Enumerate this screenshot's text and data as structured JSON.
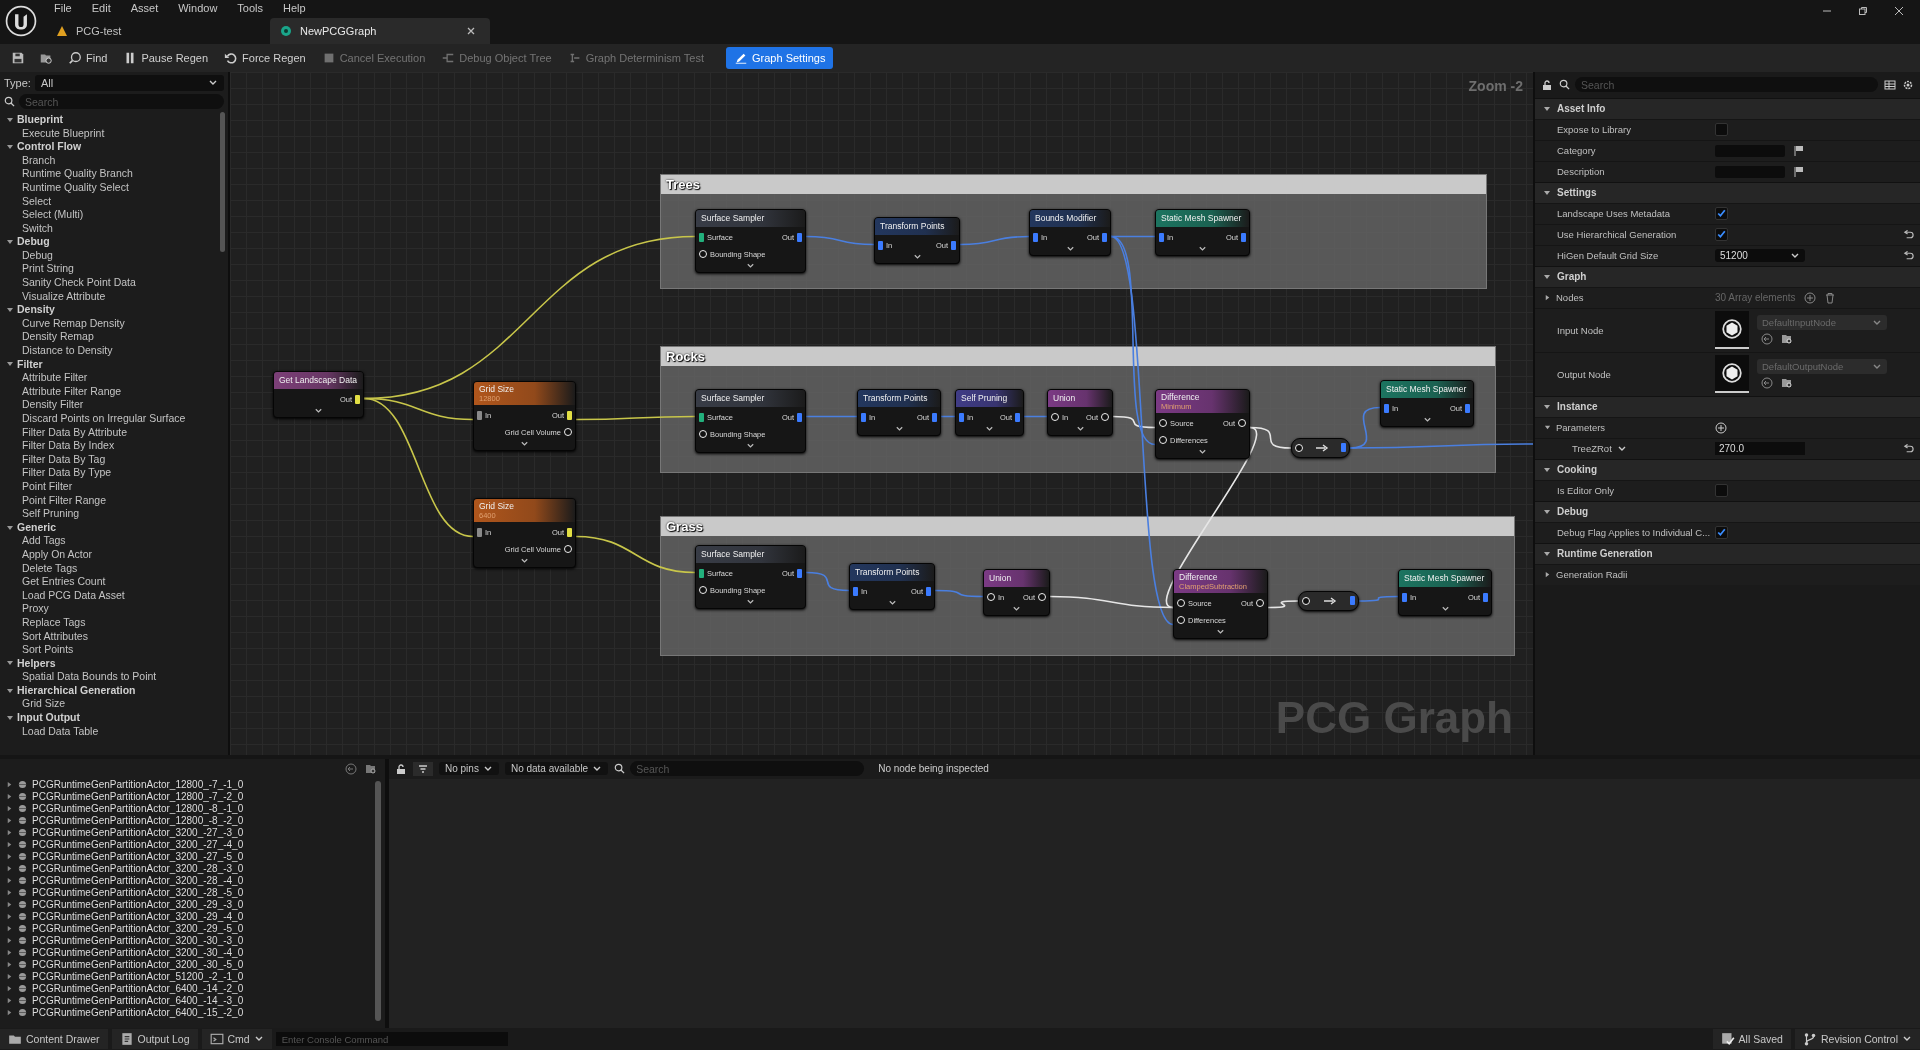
{
  "window": {
    "menu": [
      "File",
      "Edit",
      "Asset",
      "Window",
      "Tools",
      "Help"
    ],
    "tabs": [
      {
        "label": "PCG-test",
        "kind": "level",
        "selected": false
      },
      {
        "label": "NewPCGGraph",
        "kind": "graph",
        "selected": true
      }
    ]
  },
  "toolbar": {
    "items": [
      {
        "kind": "save",
        "disabled": false,
        "on": false
      },
      {
        "kind": "browse",
        "disabled": false,
        "on": false
      },
      {
        "kind": "find",
        "label": "Find",
        "disabled": false,
        "on": false
      },
      {
        "kind": "pause",
        "label": "Pause Regen",
        "disabled": false,
        "on": false
      },
      {
        "kind": "regen",
        "label": "Force Regen",
        "disabled": false,
        "on": false
      },
      {
        "kind": "cancel",
        "label": "Cancel Execution",
        "disabled": true,
        "on": false
      },
      {
        "kind": "tree",
        "label": "Debug Object Tree",
        "disabled": true,
        "on": false
      },
      {
        "kind": "determinism",
        "label": "Graph Determinism Test",
        "disabled": true,
        "on": false
      },
      {
        "kind": "settings",
        "label": "Graph Settings",
        "disabled": false,
        "on": true
      }
    ]
  },
  "palette": {
    "type_label": "Type:",
    "type_value": "All",
    "search_placeholder": "Search",
    "categories": [
      {
        "label": "Blueprint",
        "expanded": true,
        "children": [
          {
            "label": "Execute Blueprint"
          }
        ]
      },
      {
        "label": "Control Flow",
        "expanded": true,
        "children": [
          {
            "label": "Branch"
          },
          {
            "label": "Runtime Quality Branch"
          },
          {
            "label": "Runtime Quality Select"
          },
          {
            "label": "Select"
          },
          {
            "label": "Select (Multi)"
          },
          {
            "label": "Switch"
          }
        ]
      },
      {
        "label": "Debug",
        "expanded": true,
        "children": [
          {
            "label": "Debug"
          },
          {
            "label": "Print String"
          },
          {
            "label": "Sanity Check Point Data"
          },
          {
            "label": "Visualize Attribute"
          }
        ]
      },
      {
        "label": "Density",
        "expanded": true,
        "children": [
          {
            "label": "Curve Remap Density"
          },
          {
            "label": "Density Remap"
          },
          {
            "label": "Distance to Density"
          }
        ]
      },
      {
        "label": "Filter",
        "expanded": true,
        "children": [
          {
            "label": "Attribute Filter"
          },
          {
            "label": "Attribute Filter Range"
          },
          {
            "label": "Density Filter"
          },
          {
            "label": "Discard Points on Irregular Surface"
          },
          {
            "label": "Filter Data By Attribute"
          },
          {
            "label": "Filter Data By Index"
          },
          {
            "label": "Filter Data By Tag"
          },
          {
            "label": "Filter Data By Type"
          },
          {
            "label": "Point Filter"
          },
          {
            "label": "Point Filter Range"
          },
          {
            "label": "Self Pruning"
          }
        ]
      },
      {
        "label": "Generic",
        "expanded": true,
        "children": [
          {
            "label": "Add Tags"
          },
          {
            "label": "Apply On Actor"
          },
          {
            "label": "Delete Tags"
          },
          {
            "label": "Get Entries Count"
          },
          {
            "label": "Load PCG Data Asset"
          },
          {
            "label": "Proxy"
          },
          {
            "label": "Replace Tags"
          },
          {
            "label": "Sort Attributes"
          },
          {
            "label": "Sort Points"
          }
        ]
      },
      {
        "label": "Helpers",
        "expanded": true,
        "children": [
          {
            "label": "Spatial Data Bounds to Point"
          }
        ]
      },
      {
        "label": "Hierarchical Generation",
        "expanded": true,
        "children": [
          {
            "label": "Grid Size"
          }
        ]
      },
      {
        "label": "Input Output",
        "expanded": true,
        "children": [
          {
            "label": "Load Data Table"
          }
        ]
      }
    ]
  },
  "graph": {
    "zoom": "Zoom -2",
    "type_label": "PCG Graph",
    "comments": [
      {
        "title": "Trees"
      },
      {
        "title": "Rocks"
      },
      {
        "title": "Grass"
      }
    ],
    "nodes": [
      {
        "title": "Get Landscape Data",
        "kind": "landscape",
        "outputs": [
          {
            "label": "Out",
            "kind": "landscape"
          }
        ]
      },
      {
        "title": "Grid Size",
        "subtitle": "12800",
        "kind": "hierarchy",
        "inputs": [
          {
            "label": "In",
            "kind": "any"
          }
        ],
        "outputs": [
          {
            "label": "Out",
            "kind": "landscape"
          },
          {
            "label": "Grid Cell Volume",
            "kind": "concrete"
          }
        ]
      },
      {
        "title": "Grid Size",
        "subtitle": "6400",
        "kind": "hierarchy",
        "inputs": [
          {
            "label": "In",
            "kind": "any"
          }
        ],
        "outputs": [
          {
            "label": "Out",
            "kind": "landscape"
          },
          {
            "label": "Grid Cell Volume",
            "kind": "concrete"
          }
        ]
      },
      {
        "title": "Surface Sampler",
        "kind": "sampler",
        "inputs": [
          {
            "label": "Surface",
            "kind": "surface"
          },
          {
            "label": "Bounding Shape",
            "kind": "concrete"
          }
        ],
        "outputs": [
          {
            "label": "Out",
            "kind": "point"
          }
        ]
      },
      {
        "title": "Transform Points",
        "kind": "spatial",
        "inputs": [
          {
            "label": "In",
            "kind": "point"
          }
        ],
        "outputs": [
          {
            "label": "Out",
            "kind": "point"
          }
        ]
      },
      {
        "title": "Bounds Modifier",
        "kind": "spatial",
        "inputs": [
          {
            "label": "In",
            "kind": "point"
          }
        ],
        "outputs": [
          {
            "label": "Out",
            "kind": "point"
          }
        ]
      },
      {
        "title": "Static Mesh Spawner",
        "kind": "spawner",
        "inputs": [
          {
            "label": "In",
            "kind": "point"
          }
        ],
        "outputs": [
          {
            "label": "Out",
            "kind": "point"
          }
        ]
      },
      {
        "title": "Surface Sampler",
        "kind": "sampler",
        "inputs": [
          {
            "label": "Surface",
            "kind": "surface"
          },
          {
            "label": "Bounding Shape",
            "kind": "concrete"
          }
        ],
        "outputs": [
          {
            "label": "Out",
            "kind": "point"
          }
        ]
      },
      {
        "title": "Transform Points",
        "kind": "spatial",
        "inputs": [
          {
            "label": "In",
            "kind": "point"
          }
        ],
        "outputs": [
          {
            "label": "Out",
            "kind": "point"
          }
        ]
      },
      {
        "title": "Self Pruning",
        "kind": "filter",
        "inputs": [
          {
            "label": "In",
            "kind": "point"
          }
        ],
        "outputs": [
          {
            "label": "Out",
            "kind": "point"
          }
        ]
      },
      {
        "title": "Union",
        "kind": "set",
        "inputs": [
          {
            "label": "In",
            "kind": "concrete"
          }
        ],
        "outputs": [
          {
            "label": "Out",
            "kind": "concrete"
          }
        ]
      },
      {
        "title": "Difference",
        "subtitle": "Minimum",
        "kind": "set",
        "inputs": [
          {
            "label": "Source",
            "kind": "concrete"
          },
          {
            "label": "Differences",
            "kind": "concrete"
          }
        ],
        "outputs": [
          {
            "label": "Out",
            "kind": "concrete"
          }
        ]
      },
      {
        "kind": "reroute",
        "inputs": [
          {
            "kind": "concrete"
          }
        ],
        "outputs": [
          {
            "kind": "point"
          }
        ]
      },
      {
        "title": "Static Mesh Spawner",
        "kind": "spawner",
        "inputs": [
          {
            "label": "In",
            "kind": "point"
          }
        ],
        "outputs": [
          {
            "label": "Out",
            "kind": "point"
          }
        ]
      },
      {
        "title": "Surface Sampler",
        "kind": "sampler",
        "inputs": [
          {
            "label": "Surface",
            "kind": "surface"
          },
          {
            "label": "Bounding Shape",
            "kind": "concrete"
          }
        ],
        "outputs": [
          {
            "label": "Out",
            "kind": "point"
          }
        ]
      },
      {
        "title": "Transform Points",
        "kind": "spatial",
        "inputs": [
          {
            "label": "In",
            "kind": "point"
          }
        ],
        "outputs": [
          {
            "label": "Out",
            "kind": "point"
          }
        ]
      },
      {
        "title": "Union",
        "kind": "set",
        "inputs": [
          {
            "label": "In",
            "kind": "concrete"
          }
        ],
        "outputs": [
          {
            "label": "Out",
            "kind": "concrete"
          }
        ]
      },
      {
        "title": "Difference",
        "subtitle": "ClampedSubtraction",
        "kind": "set",
        "inputs": [
          {
            "label": "Source",
            "kind": "concrete"
          },
          {
            "label": "Differences",
            "kind": "concrete"
          }
        ],
        "outputs": [
          {
            "label": "Out",
            "kind": "concrete"
          }
        ]
      },
      {
        "kind": "reroute",
        "inputs": [
          {
            "kind": "concrete"
          }
        ],
        "outputs": [
          {
            "kind": "point"
          }
        ]
      },
      {
        "title": "Static Mesh Spawner",
        "kind": "spawner",
        "inputs": [
          {
            "label": "In",
            "kind": "point"
          }
        ],
        "outputs": [
          {
            "label": "Out",
            "kind": "point"
          }
        ]
      }
    ]
  },
  "details": {
    "search_placeholder": "Search",
    "sections": [
      {
        "title": "Asset Info",
        "expanded": true,
        "rows": [
          {
            "kind": "checkbox",
            "label": "Expose to Library",
            "checked": false,
            "reset": false
          },
          {
            "kind": "text",
            "label": "Category",
            "reset": false
          },
          {
            "kind": "text",
            "label": "Description",
            "reset": false
          }
        ]
      },
      {
        "title": "Settings",
        "expanded": true,
        "rows": [
          {
            "kind": "checkbox",
            "label": "Landscape Uses Metadata",
            "checked": true,
            "reset": false
          },
          {
            "kind": "checkbox",
            "label": "Use Hierarchical Generation",
            "checked": true,
            "reset": true
          },
          {
            "kind": "dropdown",
            "label": "HiGen Default Grid Size",
            "value": "51200",
            "reset": true
          }
        ]
      },
      {
        "title": "Graph",
        "expanded": true,
        "rows": [
          {
            "kind": "array",
            "label": "Nodes",
            "value": "30 Array elements",
            "expanded": false,
            "reset": false
          },
          {
            "kind": "asset",
            "label": "Input Node",
            "value": "DefaultInputNode",
            "reset": false
          },
          {
            "kind": "asset",
            "label": "Output Node",
            "value": "DefaultOutputNode",
            "reset": false
          }
        ]
      },
      {
        "title": "Instance",
        "expanded": true,
        "rows": [
          {
            "kind": "group",
            "label": "Parameters",
            "expanded": true,
            "addable": true,
            "reset": false,
            "children": [
              {
                "kind": "number",
                "label": "TreeZRot",
                "value": "270.0",
                "reset": true
              }
            ]
          }
        ]
      },
      {
        "title": "Cooking",
        "expanded": true,
        "rows": [
          {
            "kind": "checkbox",
            "label": "Is Editor Only",
            "checked": false,
            "reset": false
          }
        ]
      },
      {
        "title": "Debug",
        "expanded": true,
        "rows": [
          {
            "kind": "checkbox",
            "label": "Debug Flag Applies to Individual C...",
            "checked": true,
            "reset": false
          }
        ]
      },
      {
        "title": "Runtime Generation",
        "expanded": true,
        "rows": [
          {
            "kind": "group",
            "label": "Generation Radii",
            "expanded": false,
            "addable": false,
            "reset": false
          }
        ]
      }
    ]
  },
  "actors": {
    "items": [
      {
        "label": "PCGRuntimeGenPartitionActor_12800_-7_-1_0",
        "expanded": false
      },
      {
        "label": "PCGRuntimeGenPartitionActor_12800_-7_-2_0",
        "expanded": false
      },
      {
        "label": "PCGRuntimeGenPartitionActor_12800_-8_-1_0",
        "expanded": false
      },
      {
        "label": "PCGRuntimeGenPartitionActor_12800_-8_-2_0",
        "expanded": false
      },
      {
        "label": "PCGRuntimeGenPartitionActor_3200_-27_-3_0",
        "expanded": false
      },
      {
        "label": "PCGRuntimeGenPartitionActor_3200_-27_-4_0",
        "expanded": false
      },
      {
        "label": "PCGRuntimeGenPartitionActor_3200_-27_-5_0",
        "expanded": false
      },
      {
        "label": "PCGRuntimeGenPartitionActor_3200_-28_-3_0",
        "expanded": false
      },
      {
        "label": "PCGRuntimeGenPartitionActor_3200_-28_-4_0",
        "expanded": false
      },
      {
        "label": "PCGRuntimeGenPartitionActor_3200_-28_-5_0",
        "expanded": false
      },
      {
        "label": "PCGRuntimeGenPartitionActor_3200_-29_-3_0",
        "expanded": false
      },
      {
        "label": "PCGRuntimeGenPartitionActor_3200_-29_-4_0",
        "expanded": false
      },
      {
        "label": "PCGRuntimeGenPartitionActor_3200_-29_-5_0",
        "expanded": false
      },
      {
        "label": "PCGRuntimeGenPartitionActor_3200_-30_-3_0",
        "expanded": false
      },
      {
        "label": "PCGRuntimeGenPartitionActor_3200_-30_-4_0",
        "expanded": false
      },
      {
        "label": "PCGRuntimeGenPartitionActor_3200_-30_-5_0",
        "expanded": false
      },
      {
        "label": "PCGRuntimeGenPartitionActor_51200_-2_-1_0",
        "expanded": false
      },
      {
        "label": "PCGRuntimeGenPartitionActor_6400_-14_-2_0",
        "expanded": false
      },
      {
        "label": "PCGRuntimeGenPartitionActor_6400_-14_-3_0",
        "expanded": false
      },
      {
        "label": "PCGRuntimeGenPartitionActor_6400_-15_-2_0",
        "expanded": false
      }
    ]
  },
  "inspector": {
    "pins_filter": "No pins",
    "data_filter": "No data available",
    "search_placeholder": "Search",
    "message": "No node being inspected"
  },
  "status_bar": {
    "left": [
      {
        "kind": "drawer",
        "label": "Content Drawer"
      },
      {
        "kind": "log",
        "label": "Output Log"
      },
      {
        "kind": "cmd",
        "label": "Cmd"
      }
    ],
    "console_placeholder": "Enter Console Command",
    "right": [
      {
        "kind": "saved",
        "label": "All Saved"
      },
      {
        "kind": "revision",
        "label": "Revision Control"
      }
    ]
  }
}
